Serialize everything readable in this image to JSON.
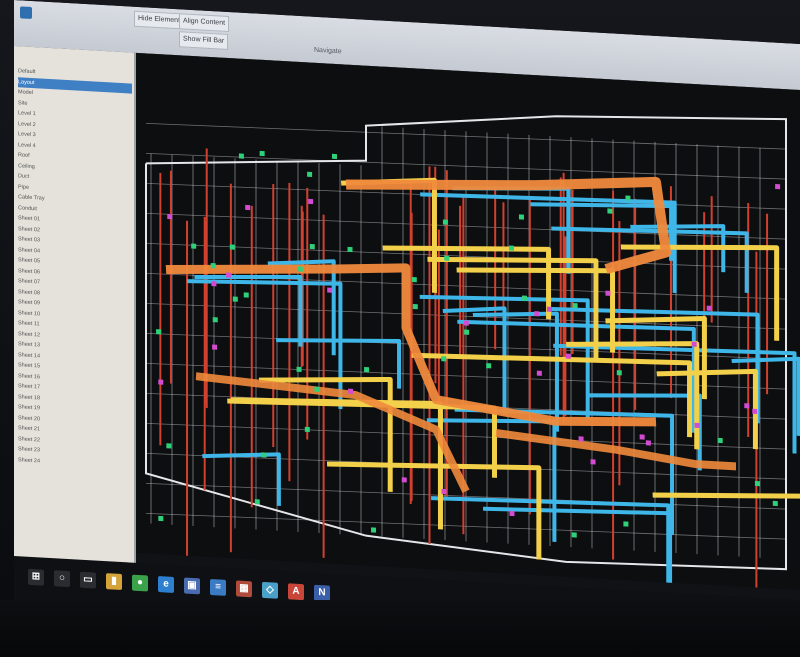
{
  "ribbon": {
    "tabs": [
      "Hide Elements",
      "Align Content",
      "Show Fill Bar"
    ],
    "group_label": "Navigate",
    "accent": "#2f6fb0"
  },
  "panel": {
    "items": [
      "Default",
      "Layout",
      "Model",
      "Site",
      "Level 1",
      "Level 2",
      "Level 3",
      "Level 4",
      "Roof",
      "Ceiling",
      "Duct",
      "Pipe",
      "Cable Tray",
      "Conduit",
      "Sheet 01",
      "Sheet 02",
      "Sheet 03",
      "Sheet 04",
      "Sheet 05",
      "Sheet 06",
      "Sheet 07",
      "Sheet 08",
      "Sheet 09",
      "Sheet 10",
      "Sheet 11",
      "Sheet 12",
      "Sheet 13",
      "Sheet 14",
      "Sheet 15",
      "Sheet 16",
      "Sheet 17",
      "Sheet 18",
      "Sheet 19",
      "Sheet 20",
      "Sheet 21",
      "Sheet 22",
      "Sheet 23",
      "Sheet 24"
    ],
    "selected_index": 1
  },
  "colors": {
    "background": "#0d0e10",
    "wall": "#e6e6ea",
    "duct_orange": "#f08a3c",
    "duct_yellow": "#f2d04a",
    "pipe_blue": "#3fb6e8",
    "pipe_red": "#d2402e",
    "fitting_green": "#2fd07a",
    "fitting_magenta": "#d24bd0"
  },
  "taskbar": {
    "icons": [
      {
        "name": "start-icon",
        "glyph": "⊞",
        "color": "#2a2c31"
      },
      {
        "name": "search-icon",
        "glyph": "○",
        "color": "#2a2c31"
      },
      {
        "name": "task-view-icon",
        "glyph": "▭",
        "color": "#2a2c31"
      },
      {
        "name": "folder-icon",
        "glyph": "▮",
        "color": "#d6a33a"
      },
      {
        "name": "chrome-icon",
        "glyph": "●",
        "color": "#3aa24a"
      },
      {
        "name": "edge-icon",
        "glyph": "e",
        "color": "#2f7fd0"
      },
      {
        "name": "store-icon",
        "glyph": "▣",
        "color": "#4a6bb0"
      },
      {
        "name": "app-icon-1",
        "glyph": "≡",
        "color": "#3a7bc4"
      },
      {
        "name": "app-icon-2",
        "glyph": "▦",
        "color": "#b04a3a"
      },
      {
        "name": "app-icon-3",
        "glyph": "◇",
        "color": "#4aa0c8"
      },
      {
        "name": "autocad-icon",
        "glyph": "A",
        "color": "#c8453a"
      },
      {
        "name": "navisworks-icon",
        "glyph": "N",
        "color": "#3a5fa8"
      }
    ]
  }
}
